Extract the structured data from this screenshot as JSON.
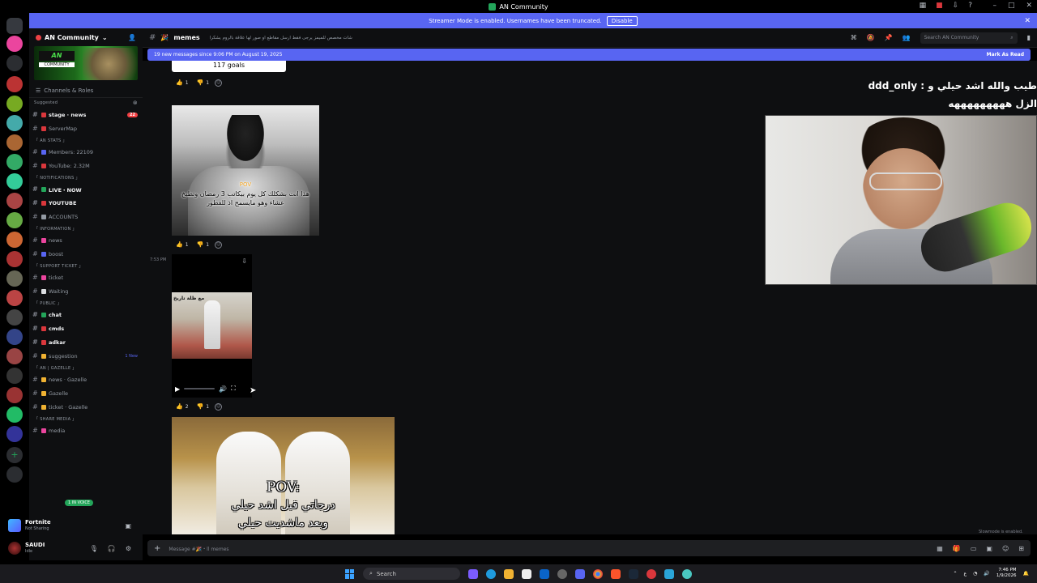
{
  "window": {
    "title": "AN Community"
  },
  "streamer_banner": {
    "text": "Streamer Mode is enabled. Usernames have been truncated.",
    "disable_label": "Disable"
  },
  "server": {
    "name": "AN Community",
    "banner_logo": "AN",
    "banner_sub": "COMMUNITY"
  },
  "sidebar": {
    "channels_roles": "Channels & Roles",
    "items": [
      {
        "type": "cat",
        "label": "Suggested"
      },
      {
        "type": "ch",
        "label": "stage · news",
        "bold": true,
        "count": "22",
        "color": "#da373c"
      },
      {
        "type": "ch",
        "label": "ServerMap",
        "color": "#da373c"
      },
      {
        "type": "cat",
        "label": "「 AN STATS 」"
      },
      {
        "type": "ch",
        "label": "Members: 22109",
        "color": "#5865f2"
      },
      {
        "type": "ch",
        "label": "YouTube: 2.32M",
        "color": "#da373c"
      },
      {
        "type": "cat",
        "label": "「 NOTIFICATIONS 」"
      },
      {
        "type": "ch",
        "label": "LIVE・NOW",
        "bold": true,
        "color": "#23a55a"
      },
      {
        "type": "ch",
        "label": "YOUTUBE",
        "bold": true,
        "color": "#da373c"
      },
      {
        "type": "ch",
        "label": "ACCOUNTS",
        "color": "#949ba4"
      },
      {
        "type": "cat",
        "label": "「 INFORMATION 」"
      },
      {
        "type": "ch",
        "label": "news",
        "color": "#eb459e"
      },
      {
        "type": "ch",
        "label": "boost",
        "color": "#5865f2"
      },
      {
        "type": "cat",
        "label": "「 SUPPORT TICKET 」"
      },
      {
        "type": "ch",
        "label": "ticket",
        "color": "#eb459e"
      },
      {
        "type": "ch",
        "label": "Waiting",
        "color": "#dbdee1"
      },
      {
        "type": "cat",
        "label": "「 PUBLIC 」"
      },
      {
        "type": "ch",
        "label": "chat",
        "bold": true,
        "color": "#23a55a"
      },
      {
        "type": "ch",
        "label": "cmds",
        "bold": true,
        "color": "#da373c"
      },
      {
        "type": "ch",
        "label": "adkar",
        "bold": true,
        "color": "#da373c"
      },
      {
        "type": "ch",
        "label": "suggestion",
        "new": "1 New",
        "color": "#f0b232"
      },
      {
        "type": "cat",
        "label": "「 AN | GAZELLE 」"
      },
      {
        "type": "ch",
        "label": "news · Gazelle",
        "color": "#f0b232"
      },
      {
        "type": "ch",
        "label": "Gazelle",
        "color": "#f0b232"
      },
      {
        "type": "ch",
        "label": "ticket · Gazelle",
        "color": "#f0b232"
      },
      {
        "type": "cat",
        "label": "「 SHARE MEDIA 」"
      },
      {
        "type": "ch",
        "label": "media",
        "color": "#eb459e"
      }
    ],
    "voice_tag": "1 IN VOICE"
  },
  "activity": {
    "game": "Fortnite",
    "status": "Not Sharing"
  },
  "user": {
    "name": "SAUDI",
    "status": "Idle"
  },
  "chat": {
    "channel": "memes",
    "topic": "شات مخصص للميمز يرجى فقط ارسل مقاطع او صور لها علاقة بالروم يشكرا",
    "search_placeholder": "Search AN Community",
    "new_messages": "19 new messages since 9:06 PM on August 19, 2025",
    "mark_read": "Mark As Read",
    "goals_text": "117 goals",
    "reactions1": {
      "up": "1",
      "down": "1"
    },
    "img1_pov": "POV",
    "img1_caption": "هذا انت بشكلك كل يوم بيكاتب 3 رمضان وتطبخ عشاء وهو مايسمح اذ للفطور",
    "reactions2": {
      "up": "1",
      "down": "1"
    },
    "timestamp": "7:53 PM",
    "video_overlay": "مع ظلة تاريخ",
    "reactions3": {
      "up": "2",
      "down": "1"
    },
    "img2_pov": "POV:",
    "img2_line1": "درجاتي قبل اشد حيلي",
    "img2_line2": "وبعد ماشديت حيلي",
    "composer_placeholder": "Message #🎉・ll memes",
    "slowmode": "Slowmode is enabled."
  },
  "cam": {
    "line1_text": "طيب والله اشد حيلي و :",
    "line1_user": "ddd_only",
    "line2": "الزل هههههههههه"
  },
  "taskbar": {
    "search": "Search",
    "time": "7:46 PM",
    "date": "1/9/2026"
  }
}
